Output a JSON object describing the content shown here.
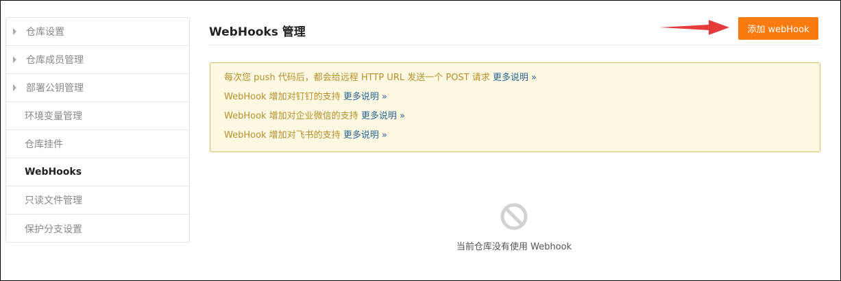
{
  "sidebar": {
    "items": [
      {
        "label": "仓库设置"
      },
      {
        "label": "仓库成员管理"
      },
      {
        "label": "部署公钥管理"
      },
      {
        "label": "环境变量管理"
      },
      {
        "label": "仓库挂件"
      },
      {
        "label": "WebHooks"
      },
      {
        "label": "只读文件管理"
      },
      {
        "label": "保护分支设置"
      }
    ]
  },
  "main": {
    "title": "WebHooks 管理",
    "add_button": "添加 webHook",
    "notice": {
      "lines": [
        {
          "text": "每次您 push 代码后，都会给远程 HTTP URL 发送一个 POST 请求",
          "link": "更多说明 »"
        },
        {
          "text": "WebHook 增加对钉钉的支持",
          "link": "更多说明 »"
        },
        {
          "text": "WebHook 增加对企业微信的支持",
          "link": "更多说明 »"
        },
        {
          "text": "WebHook 增加对飞书的支持",
          "link": "更多说明 »"
        }
      ]
    },
    "empty": {
      "icon": "no-entry-icon",
      "text": "当前仓库没有使用 Webhook"
    }
  },
  "colors": {
    "accent": "#f97a0f",
    "notice_bg": "#fcf8e1",
    "notice_border": "#d9bf63",
    "notice_text": "#b88f2a",
    "link": "#276494",
    "arrow": "#e63b3b"
  }
}
